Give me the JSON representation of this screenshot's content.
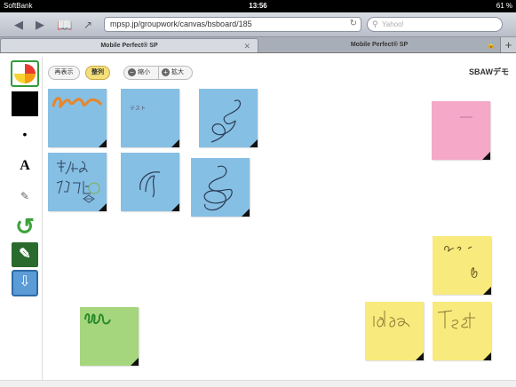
{
  "status": {
    "carrier": "SoftBank",
    "time": "13:56",
    "battery": "61 %"
  },
  "browser": {
    "url": "mpsp.jp/groupwork/canvas/bsboard/185",
    "search_placeholder": "Yahoo!",
    "tabs": [
      {
        "label": "Mobile Perfect® SP"
      },
      {
        "label": "Mobile Perfect® SP"
      }
    ]
  },
  "canvas": {
    "redisplay_label": "再表示",
    "arrange_label": "整列",
    "shrink_label": "縮小",
    "enlarge_label": "拡大",
    "brand": "SBAWデモ"
  },
  "notes": [
    {
      "color": "blue",
      "text": ""
    },
    {
      "color": "blue",
      "text": "テスト"
    },
    {
      "color": "blue",
      "text": ""
    },
    {
      "color": "blue",
      "text": ""
    },
    {
      "color": "blue",
      "text": ""
    },
    {
      "color": "blue",
      "text": ""
    },
    {
      "color": "pink",
      "text": ""
    },
    {
      "color": "yellow",
      "text": ""
    },
    {
      "color": "yellow",
      "text": ""
    },
    {
      "color": "yellow",
      "text": ""
    },
    {
      "color": "green",
      "text": ""
    }
  ]
}
